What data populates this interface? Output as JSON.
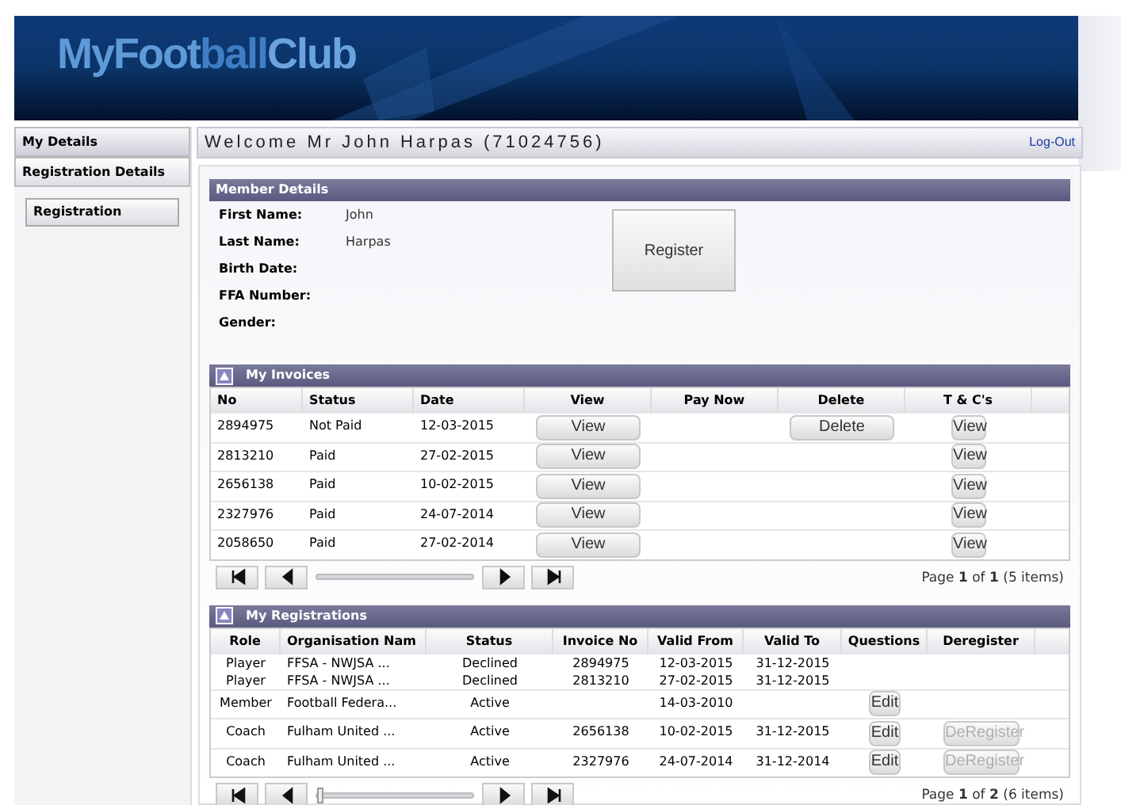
{
  "header": {
    "logo_part1": "MyFoot",
    "logo_part2": "ball",
    "logo_part3": "Club"
  },
  "sidebar": {
    "items": [
      {
        "label": "My Details",
        "selected": false
      },
      {
        "label": "Registration Details",
        "selected": true
      }
    ],
    "sub_items": [
      {
        "label": "Registration",
        "selected": true
      }
    ]
  },
  "welcome": {
    "title": "Welcome Mr John Harpas (71024756)",
    "logout": "Log-Out"
  },
  "member_details": {
    "title": "Member Details",
    "fields": [
      {
        "label": "First Name:",
        "value": "John"
      },
      {
        "label": "Last Name:",
        "value": "Harpas"
      },
      {
        "label": "Birth Date:"
      },
      {
        "label": "FFA Number:"
      },
      {
        "label": "Gender:"
      }
    ],
    "register_button": "Register"
  },
  "invoices": {
    "title": "My Invoices",
    "columns": [
      "No",
      "Status",
      "Date",
      "View",
      "Pay Now",
      "Delete",
      "T & C's"
    ],
    "rows": [
      {
        "no": "2894975",
        "status": "Not Paid",
        "date": "12-03-2015",
        "view": "View",
        "delete": "Delete",
        "tcs": "View"
      },
      {
        "no": "2813210",
        "status": "Paid",
        "date": "27-02-2015",
        "view": "View",
        "tcs": "View"
      },
      {
        "no": "2656138",
        "status": "Paid",
        "date": "10-02-2015",
        "view": "View",
        "tcs": "View"
      },
      {
        "no": "2327976",
        "status": "Paid",
        "date": "24-07-2014",
        "view": "View",
        "tcs": "View"
      },
      {
        "no": "2058650",
        "status": "Paid",
        "date": "27-02-2014",
        "view": "View",
        "tcs": "View"
      }
    ],
    "pager": {
      "text": "Page **1** of **1** (5 items)",
      "show_thumb": false
    }
  },
  "registrations": {
    "title": "My Registrations",
    "columns": [
      "Role",
      "Organisation Nam",
      "Status",
      "Invoice No",
      "Valid From",
      "Valid To",
      "Questions",
      "Deregister"
    ],
    "rows": [
      {
        "role": "Player",
        "org": "FFSA - NWJSA ...",
        "status": "Declined",
        "invoice": "2894975",
        "from": "12-03-2015",
        "to": "31-12-2015"
      },
      {
        "role": "Player",
        "org": "FFSA - NWJSA ...",
        "status": "Declined",
        "invoice": "2813210",
        "from": "27-02-2015",
        "to": "31-12-2015"
      },
      {
        "role": "Member",
        "org": "Football Federa...",
        "status": "Active",
        "from": "14-03-2010",
        "edit": "Edit"
      },
      {
        "role": "Coach",
        "org": "Fulham United ...",
        "status": "Active",
        "invoice": "2656138",
        "from": "10-02-2015",
        "to": "31-12-2015",
        "edit": "Edit",
        "deregister": {
          "label": "DeRegister",
          "disabled": true
        }
      },
      {
        "role": "Coach",
        "org": "Fulham United ...",
        "status": "Active",
        "invoice": "2327976",
        "from": "24-07-2014",
        "to": "31-12-2014",
        "edit": "Edit",
        "deregister": {
          "label": "DeRegister",
          "disabled": true
        }
      }
    ],
    "pager": {
      "text": "Page **1** of **2** (6 items)",
      "show_thumb": true
    }
  }
}
